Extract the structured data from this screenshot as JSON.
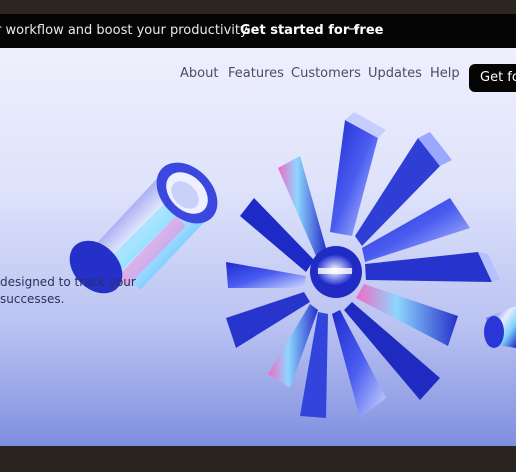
{
  "announcement": {
    "message": "r workflow and boost your productivity.",
    "cta_label": "Get started for free",
    "arrow": "→"
  },
  "nav": {
    "links": [
      "About",
      "Features",
      "Customers",
      "Updates",
      "Help"
    ],
    "cta_label": "Get fo"
  },
  "hero": {
    "line1": "designed to track your",
    "line2": "successes."
  },
  "colors": {
    "announcement_bg": "#050505",
    "hero_top": "#eef0fc",
    "hero_bottom": "#7f8fe0",
    "accent_blue": "#2f3fd6",
    "cta_bg": "#050505"
  },
  "icons": [
    "arrow-right-icon",
    "starburst-3d-graphic",
    "tube-3d-graphic"
  ]
}
